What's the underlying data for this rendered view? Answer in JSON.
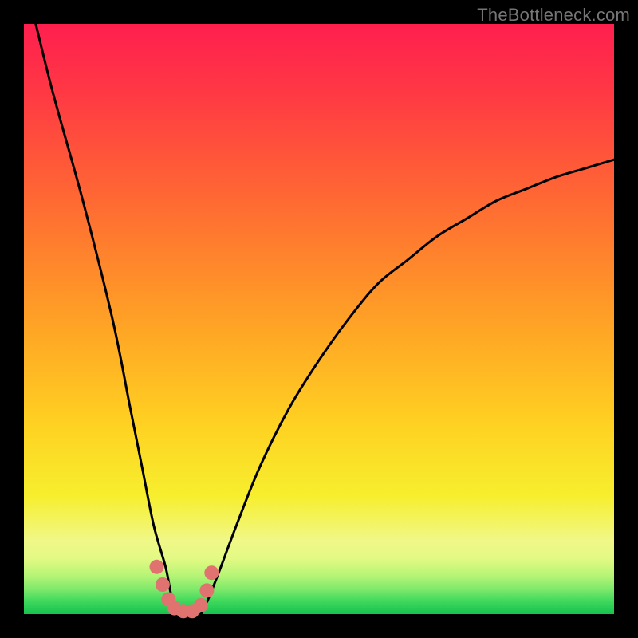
{
  "attribution": "TheBottleneck.com",
  "chart_data": {
    "type": "line",
    "title": "",
    "xlabel": "",
    "ylabel": "",
    "ylim": [
      0,
      100
    ],
    "xlim": [
      0,
      100
    ],
    "series": [
      {
        "name": "bottleneck-curve",
        "x": [
          2,
          5,
          10,
          15,
          18,
          20,
          22,
          24,
          25,
          26,
          27,
          28,
          29,
          30,
          31,
          33,
          36,
          40,
          45,
          50,
          55,
          60,
          65,
          70,
          75,
          80,
          85,
          90,
          95,
          100
        ],
        "values": [
          100,
          88,
          70,
          50,
          35,
          25,
          15,
          8,
          3,
          0,
          0,
          0,
          0,
          0,
          2,
          7,
          15,
          25,
          35,
          43,
          50,
          56,
          60,
          64,
          67,
          70,
          72,
          74,
          75.5,
          77
        ]
      }
    ],
    "markers": {
      "name": "region-dots",
      "points": [
        {
          "x": 22.5,
          "y": 8
        },
        {
          "x": 23.5,
          "y": 5
        },
        {
          "x": 24.5,
          "y": 2.5
        },
        {
          "x": 25.5,
          "y": 1
        },
        {
          "x": 27,
          "y": 0.5
        },
        {
          "x": 28.5,
          "y": 0.5
        },
        {
          "x": 30,
          "y": 1.5
        },
        {
          "x": 31,
          "y": 4
        },
        {
          "x": 31.8,
          "y": 7
        }
      ]
    },
    "gradient_stops": [
      {
        "offset": 0.0,
        "color": "#ff1f4f"
      },
      {
        "offset": 0.12,
        "color": "#ff3a44"
      },
      {
        "offset": 0.3,
        "color": "#ff6a33"
      },
      {
        "offset": 0.5,
        "color": "#ffa126"
      },
      {
        "offset": 0.68,
        "color": "#ffd222"
      },
      {
        "offset": 0.8,
        "color": "#f7ef2e"
      },
      {
        "offset": 0.875,
        "color": "#f1f887"
      },
      {
        "offset": 0.905,
        "color": "#e4fa84"
      },
      {
        "offset": 0.935,
        "color": "#b6f576"
      },
      {
        "offset": 0.958,
        "color": "#7ee96b"
      },
      {
        "offset": 0.978,
        "color": "#3fd95e"
      },
      {
        "offset": 1.0,
        "color": "#17c24e"
      }
    ]
  }
}
